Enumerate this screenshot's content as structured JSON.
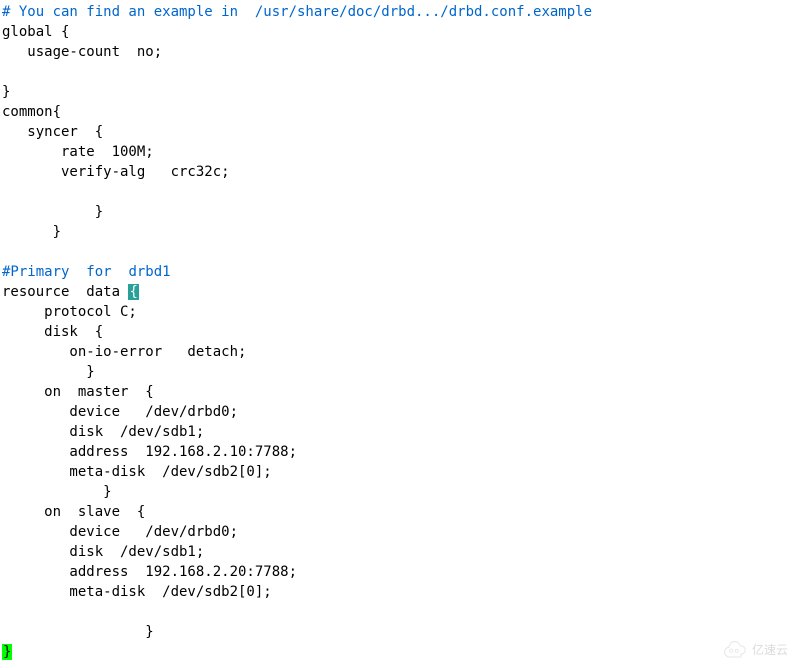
{
  "code": {
    "l01": "# You can find an example in  /usr/share/doc/drbd.../drbd.conf.example",
    "l02": "global {",
    "l03": "   usage-count  no;",
    "l04": "",
    "l05": "}",
    "l06": "common{",
    "l07": "   syncer  {",
    "l08": "       rate  100M;",
    "l09": "       verify-alg   crc32c;",
    "l10": "",
    "l11": "           }",
    "l12": "      }",
    "l13": "",
    "l14_a": "#Primary  ",
    "l14_b": "for",
    "l14_c": "  drbd1",
    "l15_a": "resource  data ",
    "l15_b": "{",
    "l16": "     protocol C;",
    "l17": "     disk  {",
    "l18": "        on-io-error   detach;",
    "l19": "          }",
    "l20": "     on  master  {",
    "l21": "        device   /dev/drbd0;",
    "l22": "        disk  /dev/sdb1;",
    "l23": "        address  192.168.2.10:7788;",
    "l24": "        meta-disk  /dev/sdb2[0];",
    "l25": "            }",
    "l26": "     on  slave  {",
    "l27": "        device   /dev/drbd0;",
    "l28": "        disk  /dev/sdb1;",
    "l29": "        address  192.168.2.20:7788;",
    "l30": "        meta-disk  /dev/sdb2[0];",
    "l31": "",
    "l32": "                 }",
    "l33": "}"
  },
  "watermark": {
    "text": "亿速云"
  }
}
